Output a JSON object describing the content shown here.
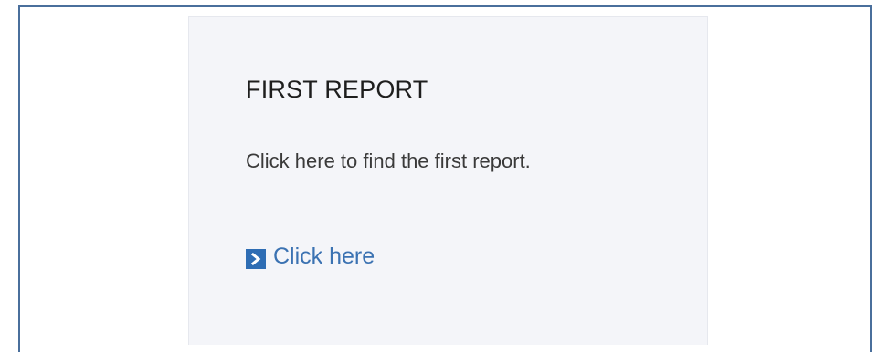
{
  "card": {
    "title": "FIRST REPORT",
    "description": "Click here to find the first report.",
    "link_label": "Click here",
    "link_icon": "chevron-right-icon"
  },
  "colors": {
    "frame_border": "#4a6f9c",
    "card_background": "#f4f5f9",
    "link": "#3b72b2",
    "link_icon_background": "#2e6db4"
  }
}
